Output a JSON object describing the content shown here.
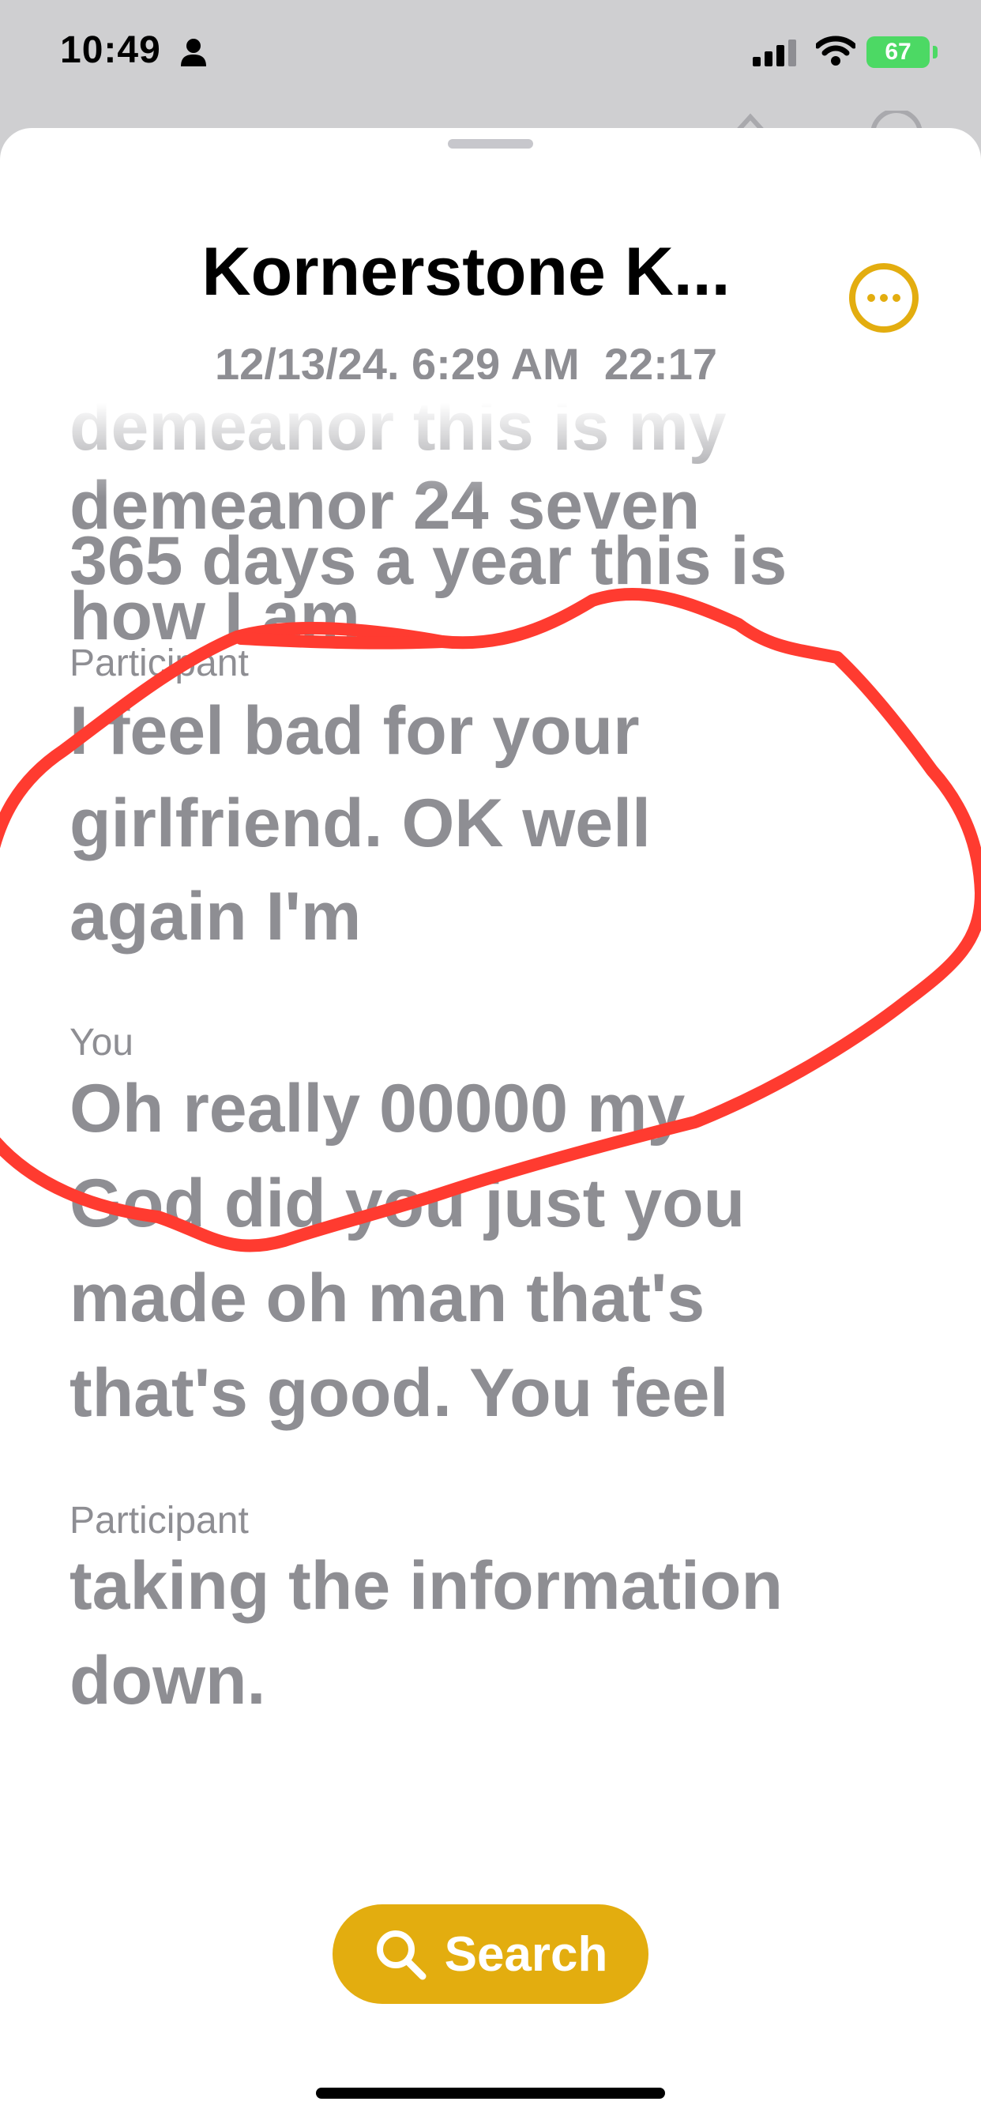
{
  "status_bar": {
    "time": "10:49",
    "battery": "67",
    "icons": [
      "person-icon",
      "cellular-signal-icon",
      "wifi-icon",
      "battery-charging-icon"
    ]
  },
  "header": {
    "title": "Kornerstone K...",
    "date": "12/13/24, 6:29 AM",
    "duration": "22:17",
    "accent_color": "#e3ad0f"
  },
  "transcript": {
    "cut_line": "demeanor this is my",
    "entries": [
      {
        "lines": [
          "demeanor 24 seven",
          "365 days a year this is",
          "how I am"
        ]
      },
      {
        "speaker": "Participant",
        "lines": [
          "I feel bad for your",
          "girlfriend. OK well",
          "again I'm"
        ]
      },
      {
        "speaker": "You",
        "lines": [
          "Oh really 00000 my",
          "God did you just you",
          "made oh man that's",
          "that's good. You feel"
        ]
      },
      {
        "speaker": "Participant",
        "lines": [
          "taking the information",
          "down."
        ]
      }
    ]
  },
  "annotation": {
    "color": "#ff3b30",
    "shape": "freehand-loop"
  },
  "search": {
    "label": "Search"
  }
}
